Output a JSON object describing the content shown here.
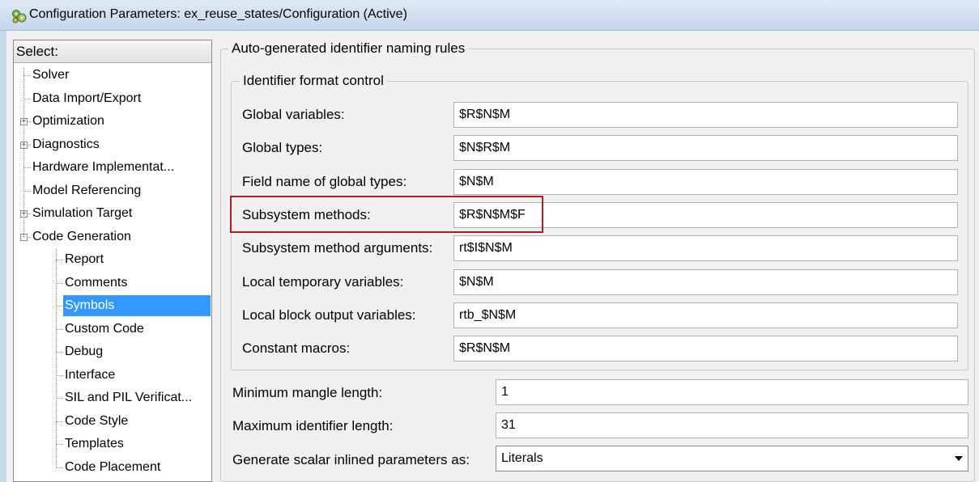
{
  "window": {
    "title": "Configuration Parameters: ex_reuse_states/Configuration (Active)",
    "icon": "gear-cluster-icon"
  },
  "tree": {
    "header": "Select:",
    "items": [
      {
        "label": "Solver",
        "level": 0,
        "expander": null,
        "selected": false
      },
      {
        "label": "Data Import/Export",
        "level": 0,
        "expander": null,
        "selected": false
      },
      {
        "label": "Optimization",
        "level": 0,
        "expander": "+",
        "selected": false
      },
      {
        "label": "Diagnostics",
        "level": 0,
        "expander": "+",
        "selected": false
      },
      {
        "label": "Hardware Implementat...",
        "level": 0,
        "expander": null,
        "selected": false
      },
      {
        "label": "Model Referencing",
        "level": 0,
        "expander": null,
        "selected": false
      },
      {
        "label": "Simulation Target",
        "level": 0,
        "expander": "+",
        "selected": false
      },
      {
        "label": "Code Generation",
        "level": 0,
        "expander": "-",
        "selected": false
      },
      {
        "label": "Report",
        "level": 1,
        "expander": null,
        "selected": false
      },
      {
        "label": "Comments",
        "level": 1,
        "expander": null,
        "selected": false
      },
      {
        "label": "Symbols",
        "level": 1,
        "expander": null,
        "selected": true
      },
      {
        "label": "Custom Code",
        "level": 1,
        "expander": null,
        "selected": false
      },
      {
        "label": "Debug",
        "level": 1,
        "expander": null,
        "selected": false
      },
      {
        "label": "Interface",
        "level": 1,
        "expander": null,
        "selected": false
      },
      {
        "label": "SIL and PIL Verificat...",
        "level": 1,
        "expander": null,
        "selected": false
      },
      {
        "label": "Code Style",
        "level": 1,
        "expander": null,
        "selected": false
      },
      {
        "label": "Templates",
        "level": 1,
        "expander": null,
        "selected": false
      },
      {
        "label": "Code Placement",
        "level": 1,
        "expander": null,
        "selected": false
      }
    ]
  },
  "naming_rules": {
    "title": "Auto-generated identifier naming rules",
    "format_control": {
      "title": "Identifier format control",
      "rows": [
        {
          "label": "Global variables:",
          "value": "$R$N$M",
          "highlighted": false
        },
        {
          "label": "Global types:",
          "value": "$N$R$M",
          "highlighted": false
        },
        {
          "label": "Field name of global types:",
          "value": "$N$M",
          "highlighted": false
        },
        {
          "label": "Subsystem methods:",
          "value": "$R$N$M$F",
          "highlighted": true
        },
        {
          "label": "Subsystem method arguments:",
          "value": "rt$I$N$M",
          "highlighted": false
        },
        {
          "label": "Local temporary variables:",
          "value": "$N$M",
          "highlighted": false
        },
        {
          "label": "Local block output variables:",
          "value": "rtb_$N$M",
          "highlighted": false
        },
        {
          "label": "Constant macros:",
          "value": "$R$N$M",
          "highlighted": false
        }
      ]
    },
    "min_mangle": {
      "label": "Minimum mangle length:",
      "value": "1"
    },
    "max_identifier": {
      "label": "Maximum identifier length:",
      "value": "31"
    },
    "scalar_inlined": {
      "label": "Generate scalar inlined parameters as:",
      "value": "Literals"
    }
  },
  "colors": {
    "selection": "#3399ff",
    "highlight_border": "#b01c1c"
  }
}
